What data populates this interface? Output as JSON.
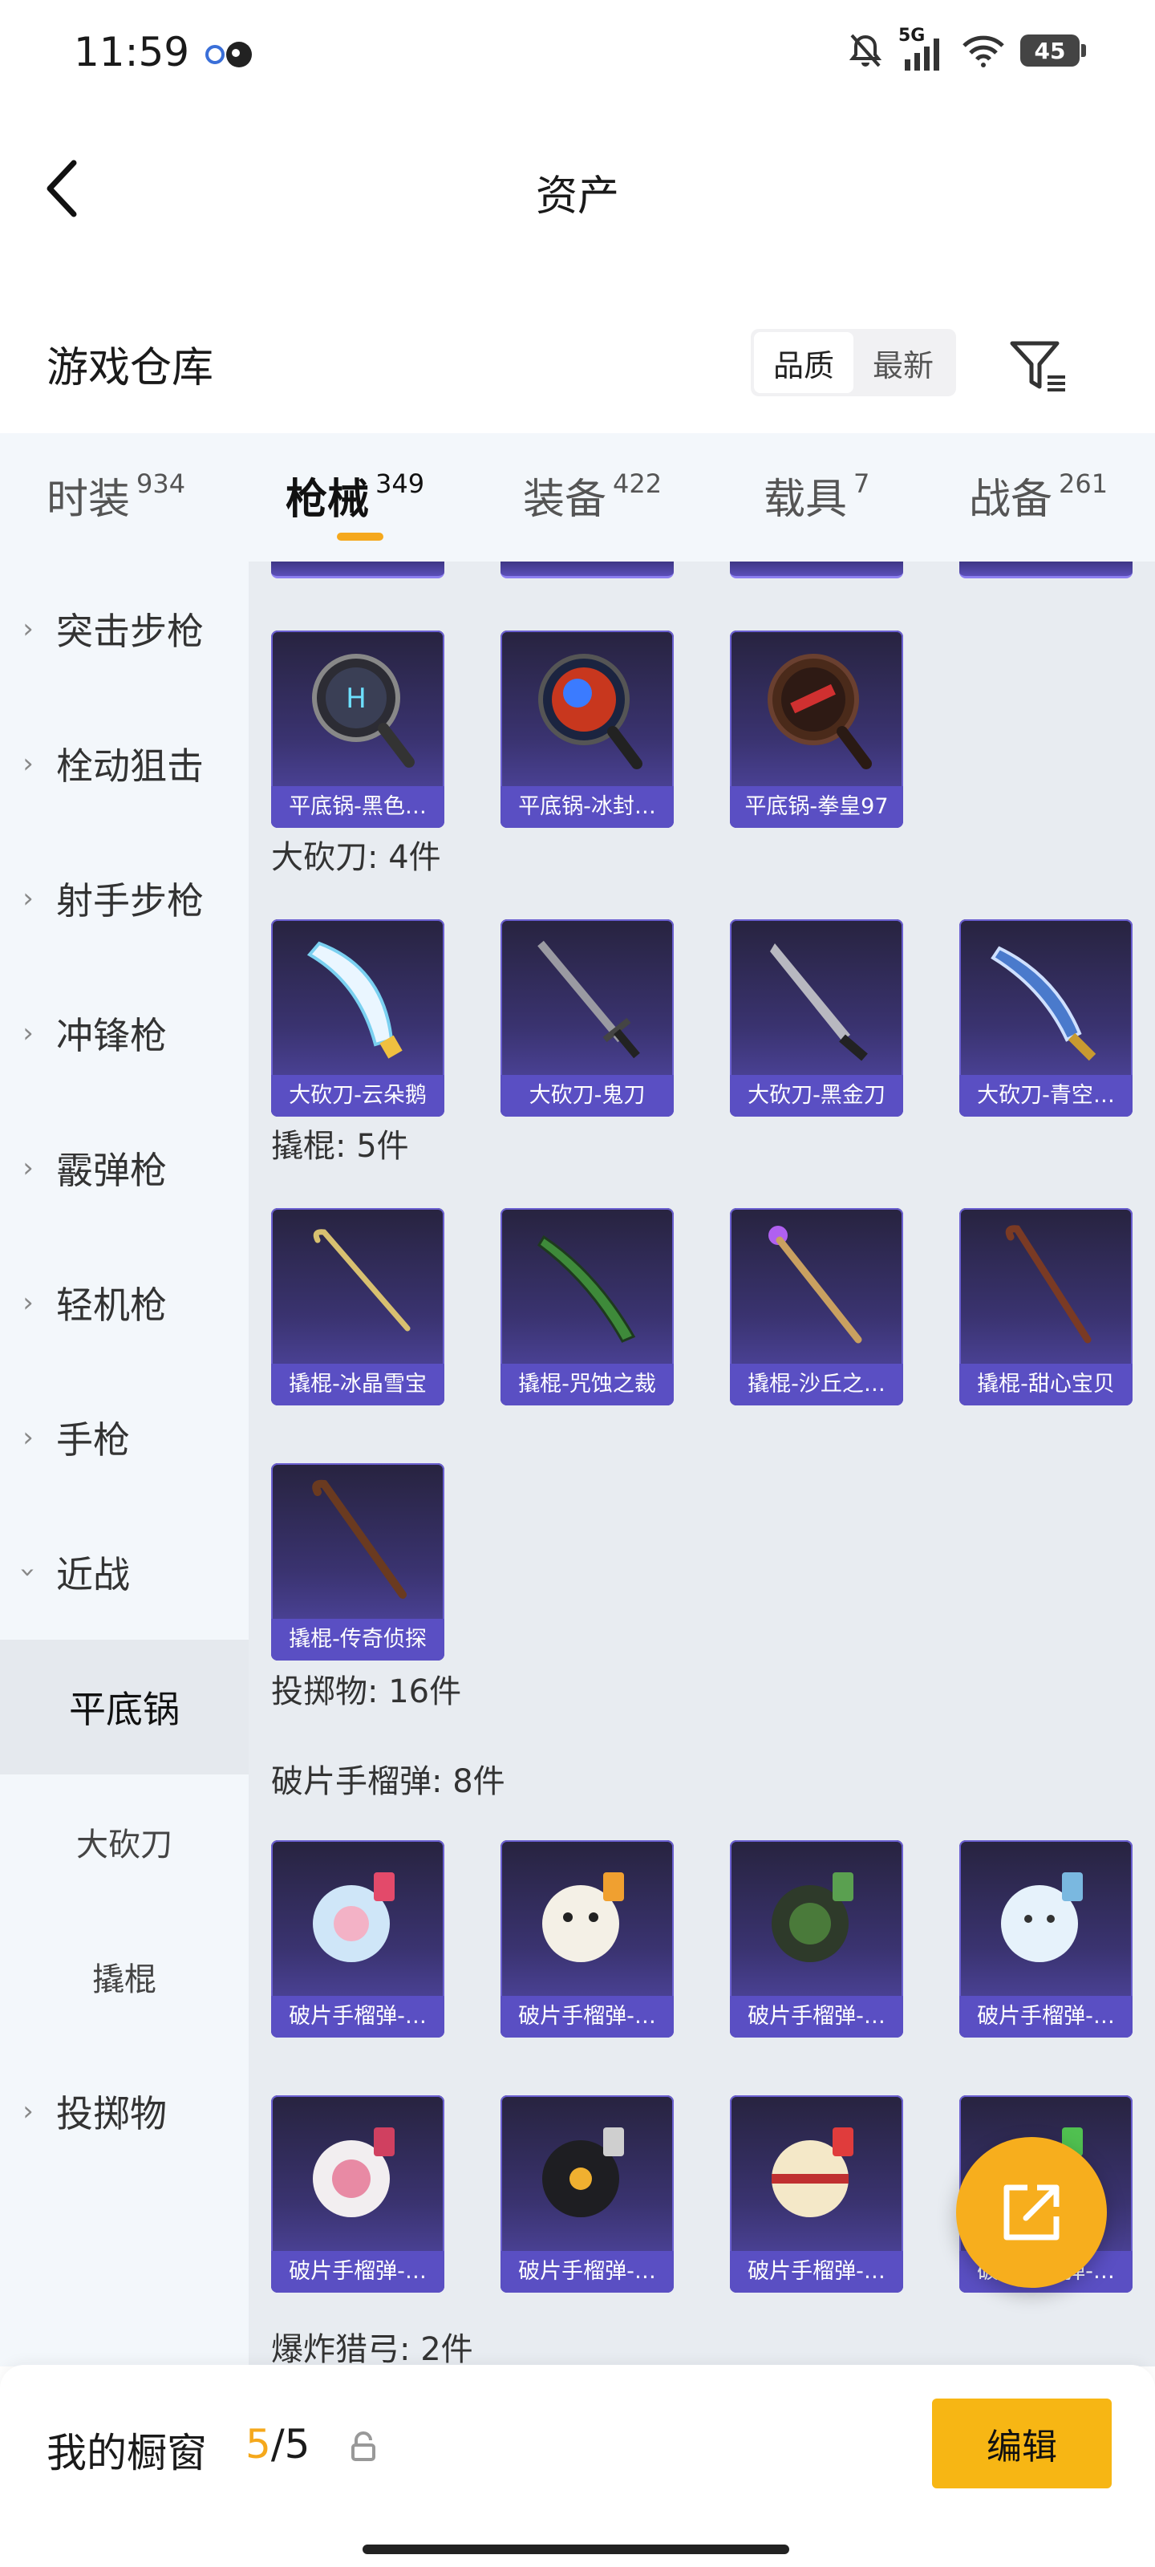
{
  "status_bar": {
    "time": "11:59",
    "network": "5G",
    "battery": "45"
  },
  "header": {
    "title": "资产"
  },
  "section": {
    "title": "游戏仓库",
    "sort_options": [
      "品质",
      "最新"
    ],
    "active_sort": "品质"
  },
  "category_tabs": [
    {
      "label": "时装",
      "count": "934"
    },
    {
      "label": "枪械",
      "count": "349"
    },
    {
      "label": "装备",
      "count": "422"
    },
    {
      "label": "载具",
      "count": "7"
    },
    {
      "label": "战备",
      "count": "261"
    }
  ],
  "active_tab": "枪械",
  "sidebar": {
    "items": [
      "突击步枪",
      "栓动狙击",
      "射手步枪",
      "冲锋枪",
      "霰弹枪",
      "轻机枪",
      "手枪",
      "近战"
    ],
    "sub_items": [
      "平底锅",
      "大砍刀",
      "撬棍"
    ],
    "selected": "平底锅",
    "after_items": [
      "投掷物"
    ]
  },
  "groups": {
    "pan_items": [
      "平底锅-黑色…",
      "平底锅-冰封…",
      "平底锅-拳皇97"
    ],
    "machete_header": "大砍刀: 4件",
    "machete_items": [
      "大砍刀-云朵鹅",
      "大砍刀-鬼刀",
      "大砍刀-黑金刀",
      "大砍刀-青空…"
    ],
    "crowbar_header": "撬棍: 5件",
    "crowbar_items": [
      "撬棍-冰晶雪宝",
      "撬棍-咒蚀之裁",
      "撬棍-沙丘之…",
      "撬棍-甜心宝贝",
      "撬棍-传奇侦探"
    ],
    "throwable_header": "投掷物: 16件",
    "grenade_header": "破片手榴弹: 8件",
    "grenade_items": [
      "破片手榴弹-…",
      "破片手榴弹-…",
      "破片手榴弹-…",
      "破片手榴弹-…",
      "破片手榴弹-…",
      "破片手榴弹-…",
      "破片手榴弹-…",
      "破片手榴弹-…"
    ],
    "bow_header": "爆炸猎弓: 2件"
  },
  "bottom_bar": {
    "label": "我的橱窗",
    "current": "5",
    "total": "/5",
    "edit_label": "编辑"
  },
  "colors": {
    "accent": "#f5a81c",
    "card_label": "#5a4fc3",
    "sidebar_bg": "#f3f7fb",
    "content_bg": "#e8ecf1"
  }
}
